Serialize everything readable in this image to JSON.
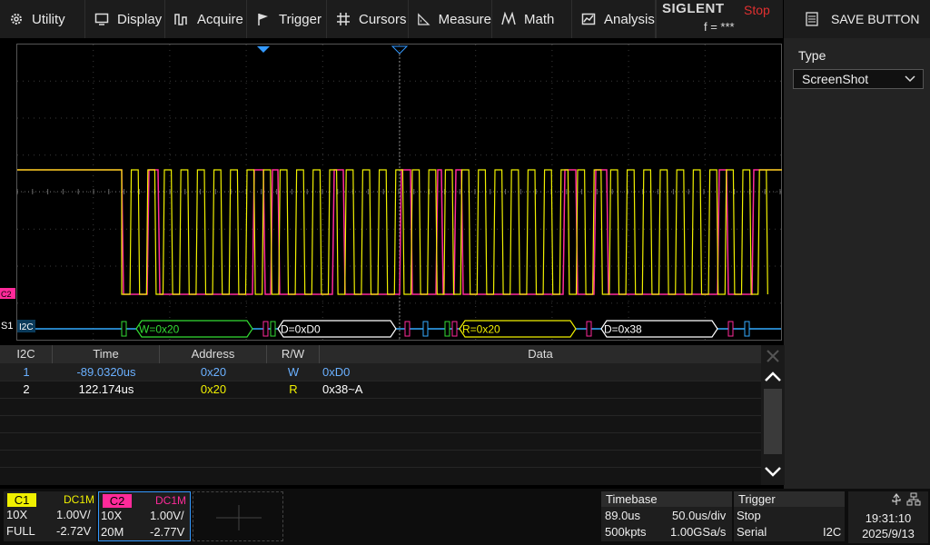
{
  "menu": {
    "utility": "Utility",
    "display": "Display",
    "acquire": "Acquire",
    "trigger": "Trigger",
    "cursors": "Cursors",
    "measure": "Measure",
    "math": "Math",
    "analysis": "Analysis"
  },
  "brand": {
    "name": "SIGLENT",
    "status": "Stop",
    "freq": "f = ***"
  },
  "right_panel": {
    "save_button": "SAVE BUTTON",
    "type_label": "Type",
    "type_value": "ScreenShot"
  },
  "waveform": {
    "ch2_marker": "C2",
    "serial_label": "S1",
    "bus_label": "I2C",
    "decode_labels": [
      "W=0x20",
      "D=0xD0",
      "R=0x20",
      "D=0x38"
    ],
    "colors": {
      "ch1": "#f0f000",
      "ch2": "#ff2a9a",
      "bus": "#33aaff",
      "grid": "#3a3a3a"
    }
  },
  "decode_table": {
    "columns": [
      "I2C",
      "Time",
      "Address",
      "R/W",
      "Data"
    ],
    "rows": [
      {
        "index": "1",
        "time": "-89.0320us",
        "address": "0x20",
        "rw": "W",
        "data": "0xD0"
      },
      {
        "index": "2",
        "time": "122.174us",
        "address": "0x20",
        "rw": "R",
        "data": "0x38~A"
      }
    ]
  },
  "channels": {
    "c1": {
      "label": "C1",
      "coupling": "DC1M",
      "probe": "10X",
      "scale": "1.00V/",
      "bw": "FULL",
      "offset": "-2.72V",
      "color": "#f0f000"
    },
    "c2": {
      "label": "C2",
      "coupling": "DC1M",
      "probe": "10X",
      "scale": "1.00V/",
      "bw": "20M",
      "offset": "-2.77V",
      "color": "#ff2a9a"
    }
  },
  "timebase": {
    "title": "Timebase",
    "delay": "89.0us",
    "scale": "50.0us/div",
    "points": "500kpts",
    "rate": "1.00GSa/s"
  },
  "trigger": {
    "title": "Trigger",
    "state": "Stop",
    "type": "Serial",
    "source": "I2C"
  },
  "clock": {
    "time": "19:31:10",
    "date": "2025/9/13"
  }
}
